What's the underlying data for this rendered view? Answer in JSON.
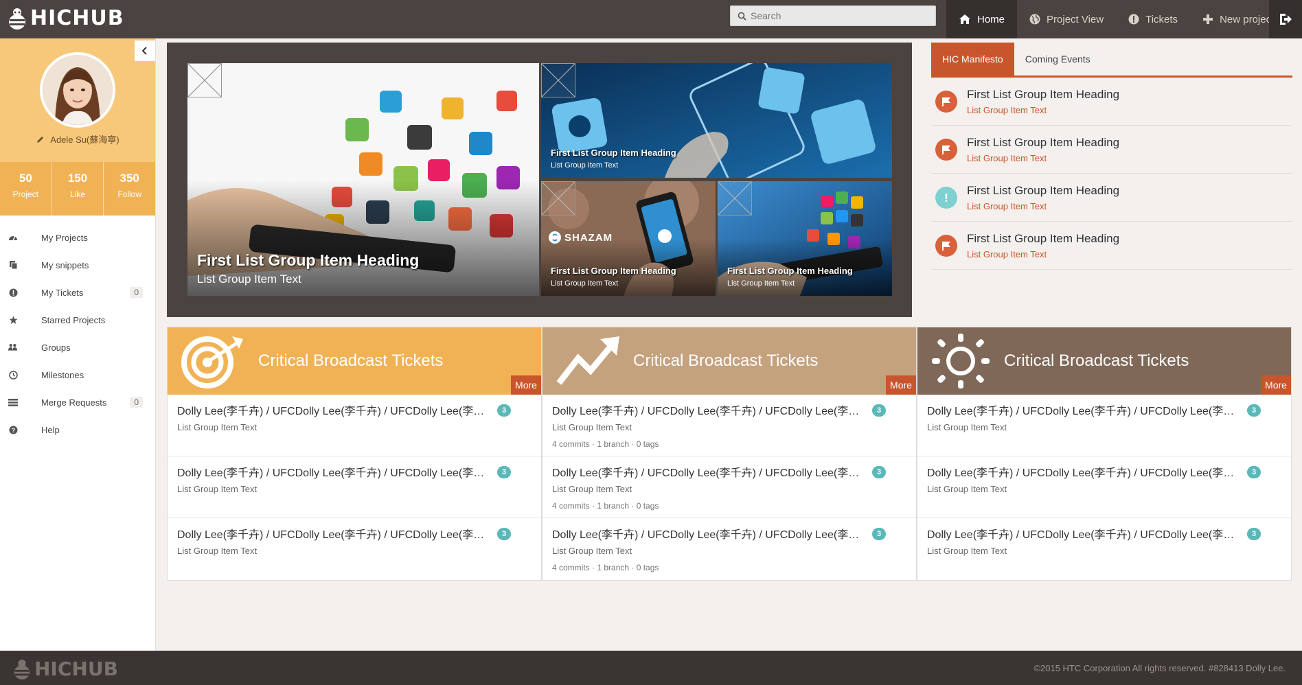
{
  "brand": {
    "logo_text": "HICHUB"
  },
  "header": {
    "search_placeholder": "Search",
    "nav": [
      {
        "label": "Home",
        "icon": "home-icon",
        "active": true
      },
      {
        "label": "Project View",
        "icon": "globe-icon",
        "active": false
      },
      {
        "label": "Tickets",
        "icon": "alert-icon",
        "active": false
      },
      {
        "label": "New project",
        "icon": "plus-icon",
        "active": false
      }
    ]
  },
  "sidebar": {
    "user_name": "Adele Su(蘇海寧)",
    "stats": [
      {
        "value": "50",
        "label": "Project"
      },
      {
        "value": "150",
        "label": "Like"
      },
      {
        "value": "350",
        "label": "Follow"
      }
    ],
    "menu": [
      {
        "label": "My Projects",
        "icon": "dashboard-icon",
        "badge": ""
      },
      {
        "label": "My snippets",
        "icon": "copy-icon",
        "badge": ""
      },
      {
        "label": "My Tickets",
        "icon": "alert-icon",
        "badge": "0"
      },
      {
        "label": "Starred Projects",
        "icon": "star-icon",
        "badge": ""
      },
      {
        "label": "Groups",
        "icon": "users-icon",
        "badge": ""
      },
      {
        "label": "Milestones",
        "icon": "clock-icon",
        "badge": ""
      },
      {
        "label": "Merge Requests",
        "icon": "list-icon",
        "badge": "0"
      },
      {
        "label": "Help",
        "icon": "question-icon",
        "badge": ""
      }
    ]
  },
  "carousel": {
    "big": {
      "heading": "First List Group Item Heading",
      "text": "List Group Item Text"
    },
    "top_right": {
      "heading": "First List Group Item Heading",
      "text": "List Group Item Text"
    },
    "bottom_mid": {
      "heading": "First List Group Item Heading",
      "text": "List Group Item Text",
      "brand": "SHAZAM"
    },
    "bottom_right": {
      "heading": "First List Group Item Heading",
      "text": "List Group Item Text"
    }
  },
  "right_panel": {
    "tabs": [
      "HIC Manifesto",
      "Coming Events"
    ],
    "items": [
      {
        "heading": "First List Group Item Heading",
        "text": "List Group Item Text",
        "icon": "flag-icon",
        "color": "#d9603a"
      },
      {
        "heading": "First List Group Item Heading",
        "text": "List Group Item Text",
        "icon": "flag-icon",
        "color": "#d9603a"
      },
      {
        "heading": "First List Group Item Heading",
        "text": "List Group Item Text",
        "icon": "exclamation-icon",
        "color": "#7fd0d0"
      },
      {
        "heading": "First List Group Item Heading",
        "text": "List Group Item Text",
        "icon": "flag-icon",
        "color": "#d9603a"
      }
    ]
  },
  "cards": [
    {
      "title": "Critical Broadcast Tickets",
      "more": "More",
      "icon": "target-icon",
      "color": "#f1b256",
      "rows": [
        {
          "heading": "Dolly Lee(李千卉) / UFCDolly Lee(李千卉) / UFCDolly Lee(李千卉)",
          "text": "List Group Item Text",
          "badge": "3",
          "meta": ""
        },
        {
          "heading": "Dolly Lee(李千卉) / UFCDolly Lee(李千卉) / UFCDolly Lee(李千卉)",
          "text": "List Group Item Text",
          "badge": "3",
          "meta": ""
        },
        {
          "heading": "Dolly Lee(李千卉) / UFCDolly Lee(李千卉) / UFCDolly Lee(李千卉)",
          "text": "List Group Item Text",
          "badge": "3",
          "meta": ""
        }
      ]
    },
    {
      "title": "Critical Broadcast Tickets",
      "more": "More",
      "icon": "trend-icon",
      "color": "#c4a27e",
      "rows": [
        {
          "heading": "Dolly Lee(李千卉) / UFCDolly Lee(李千卉) / UFCDolly Lee(李千卉)",
          "text": "List Group Item Text",
          "badge": "3",
          "meta": "4 commits · 1 branch · 0 tags"
        },
        {
          "heading": "Dolly Lee(李千卉) / UFCDolly Lee(李千卉) / UFCDolly Lee(李千卉)",
          "text": "List Group Item Text",
          "badge": "3",
          "meta": "4 commits · 1 branch · 0 tags"
        },
        {
          "heading": "Dolly Lee(李千卉) / UFCDolly Lee(李千卉) / UFCDolly Lee(李千卉)",
          "text": "List Group Item Text",
          "badge": "3",
          "meta": "4 commits · 1 branch · 0 tags"
        }
      ]
    },
    {
      "title": "Critical Broadcast Tickets",
      "more": "More",
      "icon": "sun-icon",
      "color": "#7f6858",
      "rows": [
        {
          "heading": "Dolly Lee(李千卉) / UFCDolly Lee(李千卉) / UFCDolly Lee(李千卉)",
          "text": "List Group Item Text",
          "badge": "3",
          "meta": ""
        },
        {
          "heading": "Dolly Lee(李千卉) / UFCDolly Lee(李千卉) / UFCDolly Lee(李千卉)",
          "text": "List Group Item Text",
          "badge": "3",
          "meta": ""
        },
        {
          "heading": "Dolly Lee(李千卉) / UFCDolly Lee(李千卉) / UFCDolly Lee(李千卉)",
          "text": "List Group Item Text",
          "badge": "3",
          "meta": ""
        }
      ]
    }
  ],
  "footer": {
    "logo_text": "HICHUB",
    "copyright": "©2015 HTC Corporation All rights reserved. #828413 Dolly Lee."
  }
}
